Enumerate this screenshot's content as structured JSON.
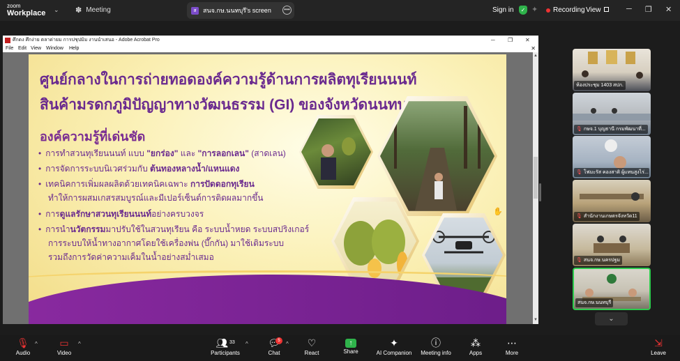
{
  "app": {
    "logo_small": "zoom",
    "logo_big": "Workplace",
    "meeting_label": "Meeting",
    "share_title": "สนจ.กษ.นนทบุรี's screen",
    "share_avatar": "ส",
    "sign_in": "Sign in",
    "recording": "Recording",
    "view": "View"
  },
  "acrobat": {
    "title": "ศึกดง ศึกง่าย ตลาด่ายม การปชุปมิม งานนำเสนอ - Adobe Acrobat Pro",
    "menu": [
      "File",
      "Edit",
      "View",
      "Window",
      "Help"
    ]
  },
  "slide": {
    "title_line1": "ศูนย์กลางในการถ่ายทอดองค์ความรู้ด้านการผลิตทุเรียนนนท์",
    "title_line2": "สินค้ามรดกภูมิปัญญาทางวัฒนธรรม (GI) ของจังหวัดนนทบุรี",
    "subtitle": "องค์ความรู้ที่เด่นชัด",
    "bullets": [
      {
        "pre": "การทำสวนทุเรียนนนท์ แบบ ",
        "b1": "\"ยกร่อง\"",
        "mid": " และ ",
        "b2": "\"การลอกเลน\"",
        "post": " (สาดเลน)"
      },
      {
        "pre": "การจัดการระบบนิเวศร่วมกับ ",
        "b1": "ต้นทองหลางน้ำ/แหนแดง",
        "mid": "",
        "b2": "",
        "post": ""
      },
      {
        "pre": "เทคนิคการเพิ่มผลผลิตด้วยเทคนิคเฉพาะ ",
        "b1": "การปัดดอกทุเรียน",
        "mid": "",
        "b2": "",
        "post": ""
      },
      {
        "pre": "การ",
        "b1": "ดูแลรักษาสวนทุเรียนนนท์",
        "mid": "อย่างครบวงจร",
        "b2": "",
        "post": ""
      },
      {
        "pre": "การนำ",
        "b1": "นวัตกรรม",
        "mid": "มาปรับใช้ในสวนทุเรียน คือ ระบบน้ำหยด ระบบสปริงเกอร์",
        "b2": "",
        "post": ""
      }
    ],
    "continuations": [
      "ทำให้การผสมเกสรสมบูรณ์และมีเปอร์เซ็นต์การติดผลมากขึ้น",
      "การระบบให้น้ำทางอากาศโดยใช้เครื่องพ่น (บึ๊กกัน) มาใช้เติมระบบ",
      "รวมถึงการวัดค่าความเค็มในน้ำอย่างสม่ำเสมอ"
    ]
  },
  "participants": [
    {
      "name": "ห้องประชุม 1403 สปก.",
      "muted": false
    },
    {
      "name": "กษจ.1 บุญธานี กรมพัฒนาที่...",
      "muted": true
    },
    {
      "name": "โฟมะรัส คองสาดิ ผู้แทนสูงไร่...",
      "muted": true
    },
    {
      "name": "สำนักงานเกษตรจังหวัด11",
      "muted": true
    },
    {
      "name": "สนจ.กษ.นครปฐม",
      "muted": true
    },
    {
      "name": "สนจ.กษ.นนทบุรี",
      "muted": false
    }
  ],
  "toolbar": {
    "audio": "Audio",
    "video": "Video",
    "participants": "Participants",
    "participants_count": "33",
    "chat": "Chat",
    "chat_badge": "5",
    "react": "React",
    "share": "Share",
    "ai_companion": "AI Companion",
    "meeting_info": "Meeting info",
    "apps": "Apps",
    "more": "More",
    "leave": "Leave"
  }
}
